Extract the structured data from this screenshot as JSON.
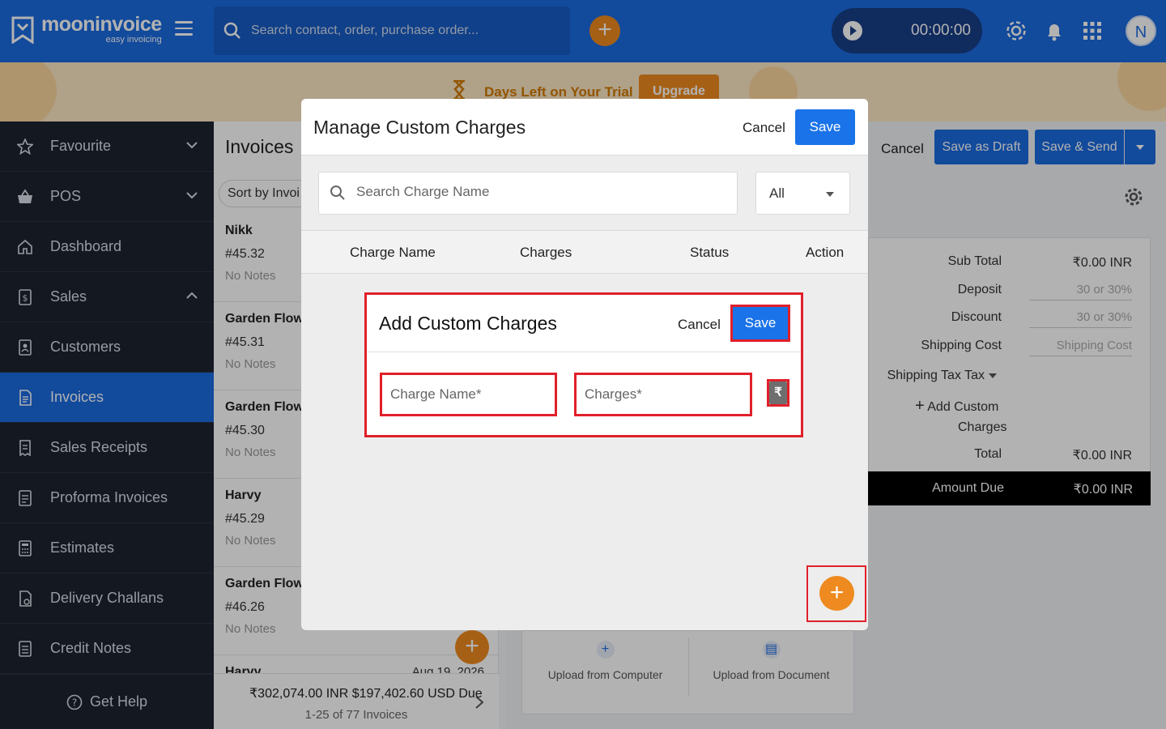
{
  "brand": {
    "name": "mooninvoice",
    "tagline": "easy invoicing"
  },
  "topbar": {
    "search_placeholder": "Search contact, order, purchase order...",
    "timer": "00:00:00",
    "avatar_initial": "N"
  },
  "banner": {
    "text": "Days Left on Your Trial",
    "upgrade_label": "Upgrade"
  },
  "sidebar": {
    "items": [
      {
        "label": "Favourite"
      },
      {
        "label": "POS"
      },
      {
        "label": "Dashboard"
      },
      {
        "label": "Sales"
      },
      {
        "label": "Customers"
      },
      {
        "label": "Invoices"
      },
      {
        "label": "Sales Receipts"
      },
      {
        "label": "Proforma Invoices"
      },
      {
        "label": "Estimates"
      },
      {
        "label": "Delivery Challans"
      },
      {
        "label": "Credit Notes"
      }
    ],
    "help_label": "Get Help"
  },
  "list": {
    "title": "Invoices",
    "sort_label": "Sort by",
    "sort_value": "Invoi",
    "rows": [
      {
        "name": "Nikk",
        "number": "#45.32",
        "notes": "No Notes"
      },
      {
        "name": "Garden Flowe",
        "number": "#45.31",
        "notes": "No Notes"
      },
      {
        "name": "Garden Flowe",
        "number": "#45.30",
        "notes": "No Notes"
      },
      {
        "name": "Harvy",
        "number": "#45.29",
        "notes": "No Notes"
      },
      {
        "name": "Garden Flowe",
        "number": "#46.26",
        "notes": "No Notes"
      },
      {
        "name": "Harvy",
        "date": "Aug 19, 2026"
      }
    ],
    "totals": "₹302,074.00 INR  $197,402.60 USD  Due",
    "range": "1-25 of 77 Invoices"
  },
  "editor": {
    "cancel_label": "Cancel",
    "save_draft_label": "Save as Draft",
    "save_send_label": "Save & Send",
    "totals": {
      "sub_total_label": "Sub Total",
      "sub_total_value": "₹0.00 INR",
      "deposit_label": "Deposit",
      "deposit_placeholder": "30 or 30%",
      "discount_label": "Discount",
      "discount_placeholder": "30 or 30%",
      "shipping_label": "Shipping Cost",
      "shipping_placeholder": "Shipping Cost",
      "tax_label": "Shipping Tax  Tax",
      "add_custom_label": "Add Custom",
      "add_custom_label2": "Charges",
      "total_label": "Total",
      "total_value": "₹0.00 INR",
      "amount_due_label": "Amount Due",
      "amount_due_value": "₹0.00 INR"
    },
    "upload": {
      "computer_label": "Upload from Computer",
      "document_label": "Upload from Document"
    }
  },
  "manage_modal": {
    "title": "Manage Custom Charges",
    "cancel_label": "Cancel",
    "save_label": "Save",
    "search_placeholder": "Search Charge Name",
    "filter_value": "All",
    "columns": [
      "Charge Name",
      "Charges",
      "Status",
      "Action"
    ]
  },
  "add_modal": {
    "title": "Add Custom Charges",
    "cancel_label": "Cancel",
    "save_label": "Save",
    "charge_name_placeholder": "Charge Name*",
    "charges_placeholder": "Charges*",
    "currency_symbol": "₹"
  },
  "colors": {
    "primary": "#1a6ae0",
    "accent_orange": "#ee8a1f",
    "sidebar_bg": "#1d2330",
    "highlight_red": "#e0202a"
  }
}
